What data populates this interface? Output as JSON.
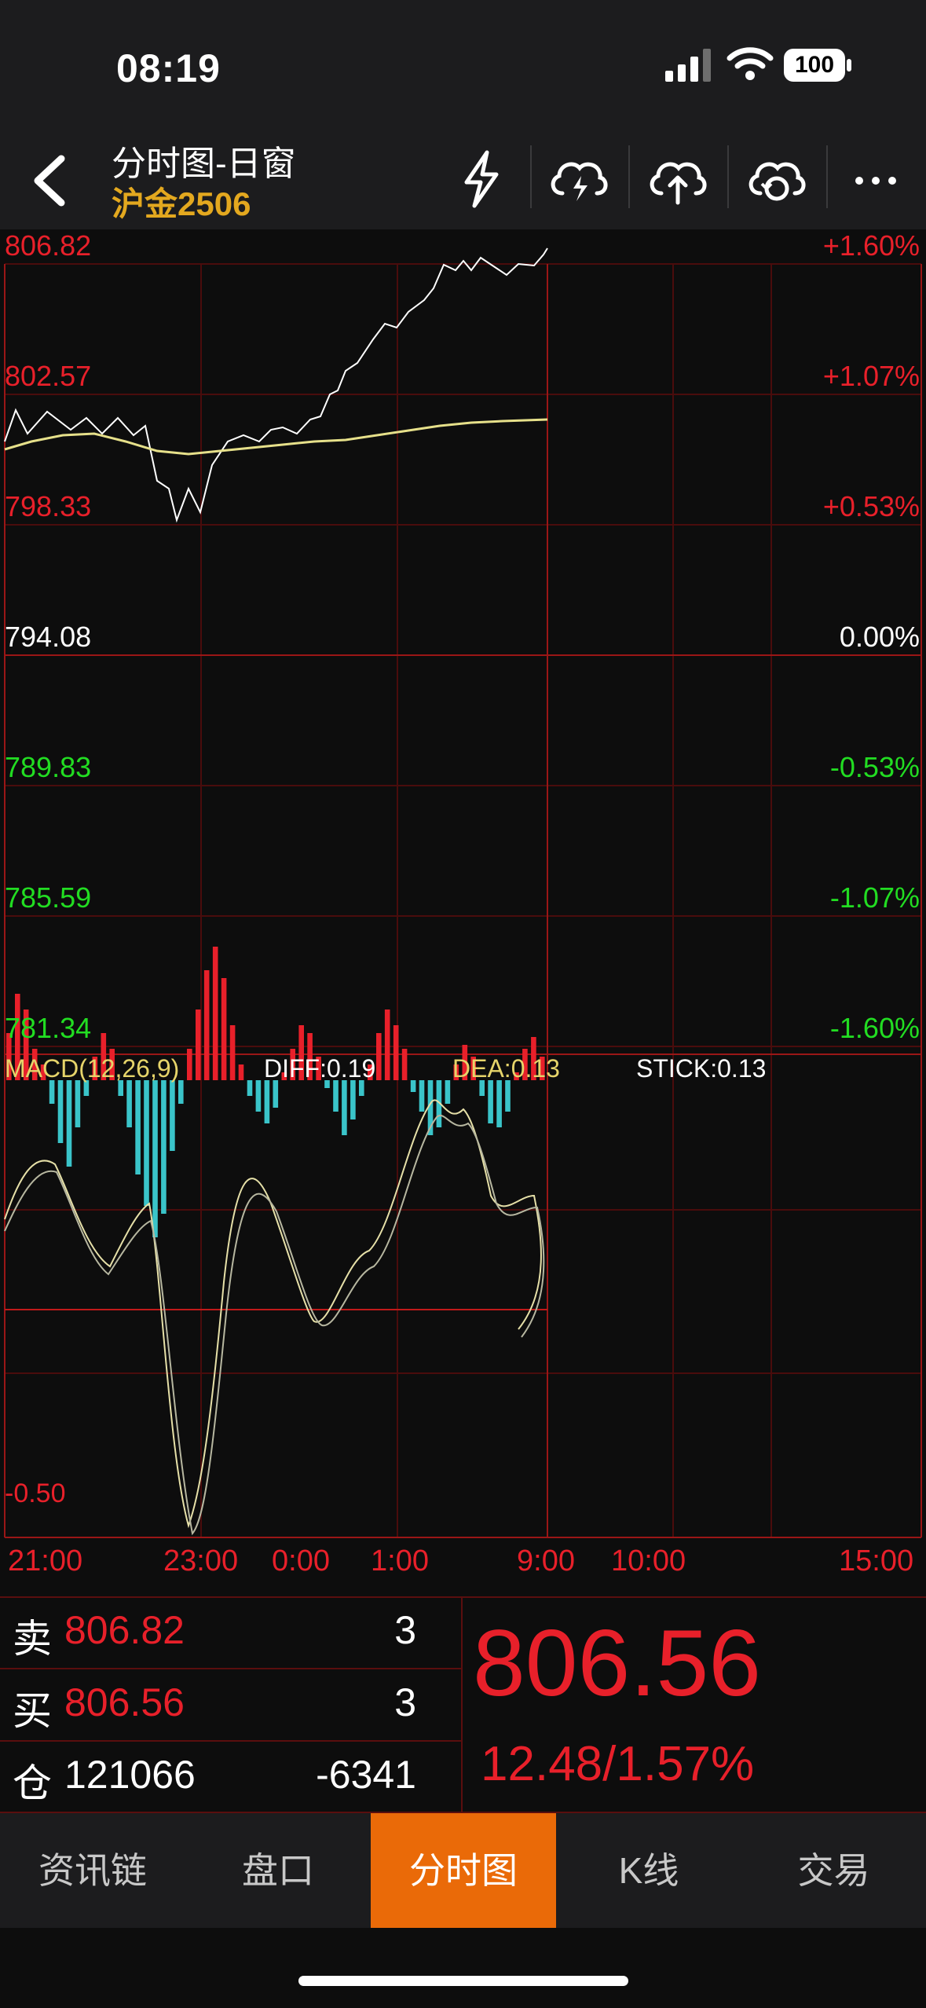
{
  "status_bar": {
    "time": "08:19",
    "battery": "100"
  },
  "nav": {
    "title": "分时图-日窗",
    "subtitle": "沪金2506",
    "icons": [
      "flash-icon",
      "cloud-lightning-icon",
      "cloud-upload-icon",
      "cloud-sync-icon",
      "more-icon"
    ]
  },
  "price_axis": {
    "left": [
      "806.82",
      "802.57",
      "798.33",
      "794.08",
      "789.83",
      "785.59",
      "781.34"
    ],
    "right": [
      "+1.60%",
      "+1.07%",
      "+0.53%",
      "0.00%",
      "-0.53%",
      "-1.07%",
      "-1.60%"
    ]
  },
  "macd": {
    "title": "MACD(12,26,9)",
    "diff": "DIFF:0.19",
    "dea": "DEA:0.13",
    "stick": "STICK:0.13",
    "axis_label": "-0.50"
  },
  "time_axis": [
    "21:00",
    "23:00",
    "0:00",
    "1:00",
    "9:00",
    "10:00",
    "15:00"
  ],
  "quote": {
    "sell_label": "卖",
    "sell_price": "806.82",
    "sell_vol": "3",
    "buy_label": "买",
    "buy_price": "806.56",
    "buy_vol": "3",
    "oi_label": "仓",
    "oi_value": "121066",
    "oi_change": "-6341",
    "last_price": "806.56",
    "change": "12.48/1.57%"
  },
  "tabs": [
    "资讯链",
    "盘口",
    "分时图",
    "K线",
    "交易"
  ],
  "active_tab": "分时图",
  "colors": {
    "up": "#e8202a",
    "down": "#22dd22",
    "accent": "#ea6a08",
    "subtitle": "#e3a81f",
    "avg_line": "#e6e08a",
    "macd_neg": "#3ac4c9"
  }
}
